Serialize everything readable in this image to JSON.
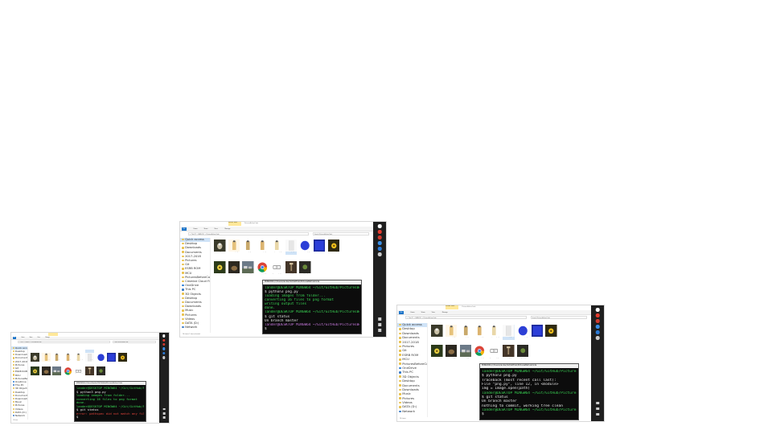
{
  "slide": {
    "background": "#ffffff"
  },
  "screenshots": [
    {
      "id": "left",
      "explorer": {
        "title_tab": "Picture Tools",
        "title_path": "PicturesBeforeCode",
        "ribbon_tabs": [
          "File",
          "Home",
          "Share",
          "View",
          "Manage"
        ],
        "address": "> This PC > DATA (D:) > PicturesBeforeCode",
        "search_placeholder": "Search PicturesBeforeCode",
        "nav": [
          "Quick access",
          "Desktop",
          "Downloads",
          "Documents",
          "2017-2018",
          "Pictures",
          "Git",
          "ESRB ROM",
          "MCU",
          "PicturesBeforeCode",
          "OneDrive",
          "This PC",
          "3D Objects",
          "Desktop",
          "Documents",
          "Downloads",
          "Music",
          "Pictures",
          "Videos",
          "DATA (D:)",
          "Network"
        ],
        "status": "16 items"
      },
      "terminal": {
        "title": "MINGW64:/c/Users/lander/Git/GitHub/PicturesBeforeCode",
        "lines": [
          {
            "text": "lander@DESKTOP MINGW64 ~/Git/GitHub/PicturesBeforeCode (master)",
            "color": "#39d353"
          },
          {
            "text": "$ python3 png.py",
            "color": "#e6e6e6"
          },
          {
            "text": "loading images from folder...",
            "color": "#39d353"
          },
          {
            "text": "converting 16 files to png format",
            "color": "#39d353"
          },
          {
            "text": "done.",
            "color": "#39d353"
          },
          {
            "text": "lander@DESKTOP MINGW64 ~/Git/GitHub/PicturesBeforeCode (master)",
            "color": "#39d353"
          },
          {
            "text": "$ git status",
            "color": "#e6e6e6"
          },
          {
            "text": "error: pathspec did not match any files",
            "color": "#e0433a"
          },
          {
            "text": "$",
            "color": "#e6e6e6"
          }
        ]
      }
    },
    {
      "id": "center",
      "explorer": {
        "title_tab": "Picture Tools",
        "title_path": "PicturesBeforeCode",
        "ribbon_tabs": [
          "File",
          "Home",
          "Share",
          "View",
          "Manage"
        ],
        "address": "> This PC > DATA (D:) > PicturesBeforeCode",
        "search_placeholder": "Search PicturesBeforeCode",
        "nav": [
          "Quick access",
          "Desktop",
          "Downloads",
          "Documents",
          "2017-2018",
          "Pictures",
          "Git",
          "ESRB ROM",
          "MCU",
          "PicturesBeforeCode",
          "Creative Cloud Files",
          "OneDrive",
          "This PC",
          "3D Objects",
          "Desktop",
          "Documents",
          "Downloads",
          "Music",
          "Pictures",
          "Videos",
          "DATA (D:)",
          "Network"
        ],
        "status": "16 items    1 item selected"
      },
      "terminal": {
        "title": "MINGW64:/c/Users/lander/Git/GitHub/PicturesBeforeCode",
        "lines": [
          {
            "text": "lander@DESKTOP MINGW64 ~/Git/GitHub/PicturesBeforeCode (master)",
            "color": "#39d353"
          },
          {
            "text": "$ python3 png.py",
            "color": "#e6e6e6"
          },
          {
            "text": "loading images from folder...",
            "color": "#39d353"
          },
          {
            "text": "converting 16 files to png format",
            "color": "#39d353"
          },
          {
            "text": "writing output files",
            "color": "#39d353"
          },
          {
            "text": "done.",
            "color": "#39d353"
          },
          {
            "text": "lander@DESKTOP MINGW64 ~/Git/GitHub/PicturesBeforeCode (master)",
            "color": "#39d353"
          },
          {
            "text": "$ git status",
            "color": "#e6e6e6"
          },
          {
            "text": "On branch master",
            "color": "#e6e6e6"
          },
          {
            "text": "lander@DESKTOP MINGW64 ~/Git/GitHub/PicturesBeforeCode (master)",
            "color": "#c678dd"
          },
          {
            "text": "$",
            "color": "#e6e6e6"
          }
        ]
      }
    },
    {
      "id": "right",
      "explorer": {
        "title_tab": "Picture Tools",
        "title_path": "PicturesBeforeCode",
        "ribbon_tabs": [
          "File",
          "Home",
          "Share",
          "View",
          "Manage"
        ],
        "address": "> This PC > DATA (D:) > PicturesBeforeCode",
        "search_placeholder": "Search PicturesBeforeCode",
        "nav": [
          "Quick access",
          "Desktop",
          "Downloads",
          "Documents",
          "2017-2018",
          "Pictures",
          "Git",
          "ESRB ROM",
          "MCU",
          "PicturesBeforeCode",
          "OneDrive",
          "This PC",
          "3D Objects",
          "Desktop",
          "Documents",
          "Downloads",
          "Music",
          "Pictures",
          "Videos",
          "DATA (D:)",
          "Network"
        ],
        "status": "16 items"
      },
      "terminal": {
        "title": "MINGW64:/c/Users/lander/Git/GitHub/PicturesBeforeCode",
        "lines": [
          {
            "text": "lander@DESKTOP MINGW64 ~/Git/GitHub/PicturesBeforeCode (master)",
            "color": "#39d353"
          },
          {
            "text": "$ python3 png.py",
            "color": "#e6e6e6"
          },
          {
            "text": "Traceback (most recent call last):",
            "color": "#e6e6e6"
          },
          {
            "text": "  File \"png.py\", line 12, in <module>",
            "color": "#e6e6e6"
          },
          {
            "text": "    img = Image.open(path)",
            "color": "#e6e6e6"
          },
          {
            "text": "lander@DESKTOP MINGW64 ~/Git/GitHub/PicturesBeforeCode (master)",
            "color": "#39d353"
          },
          {
            "text": "$ git status",
            "color": "#e6e6e6"
          },
          {
            "text": "On branch master",
            "color": "#e6e6e6"
          },
          {
            "text": "nothing to commit, working tree clean",
            "color": "#e6e6e6"
          },
          {
            "text": "lander@DESKTOP MINGW64 ~/Git/GitHub/PicturesBeforeCode (master)",
            "color": "#39d353"
          },
          {
            "text": "$",
            "color": "#e6e6e6"
          }
        ]
      }
    }
  ],
  "files": [
    {
      "name": "1.jpg",
      "kind": "dog",
      "selected": false
    },
    {
      "name": "Batman.png",
      "kind": "figure",
      "selected": false
    },
    {
      "name": "bear.png",
      "kind": "figure2",
      "selected": false
    },
    {
      "name": "builder.png",
      "kind": "figure3",
      "selected": false
    },
    {
      "name": "fakepicture.png",
      "kind": "figure4",
      "selected": false
    },
    {
      "name": "blank.png",
      "kind": "white",
      "selected": true
    },
    {
      "name": "blue-circle.png",
      "kind": "circle",
      "selected": false
    },
    {
      "name": "blue-square.png",
      "kind": "square",
      "selected": false
    },
    {
      "name": "flower-sun.jpg",
      "kind": "flower",
      "selected": false
    },
    {
      "name": "flowerpic.png",
      "kind": "flower2",
      "selected": false
    },
    {
      "name": "Hamster.jpg",
      "kind": "hamster",
      "selected": false
    },
    {
      "name": "houses.jpg",
      "kind": "houses",
      "selected": false
    },
    {
      "name": "chrome.png",
      "kind": "chrome",
      "selected": false
    },
    {
      "name": "greenbox.png",
      "kind": "greenbox",
      "selected": false
    },
    {
      "name": "lamp.jpg",
      "kind": "lamp",
      "selected": false
    },
    {
      "name": "sign.png",
      "kind": "sign",
      "selected": false
    }
  ]
}
